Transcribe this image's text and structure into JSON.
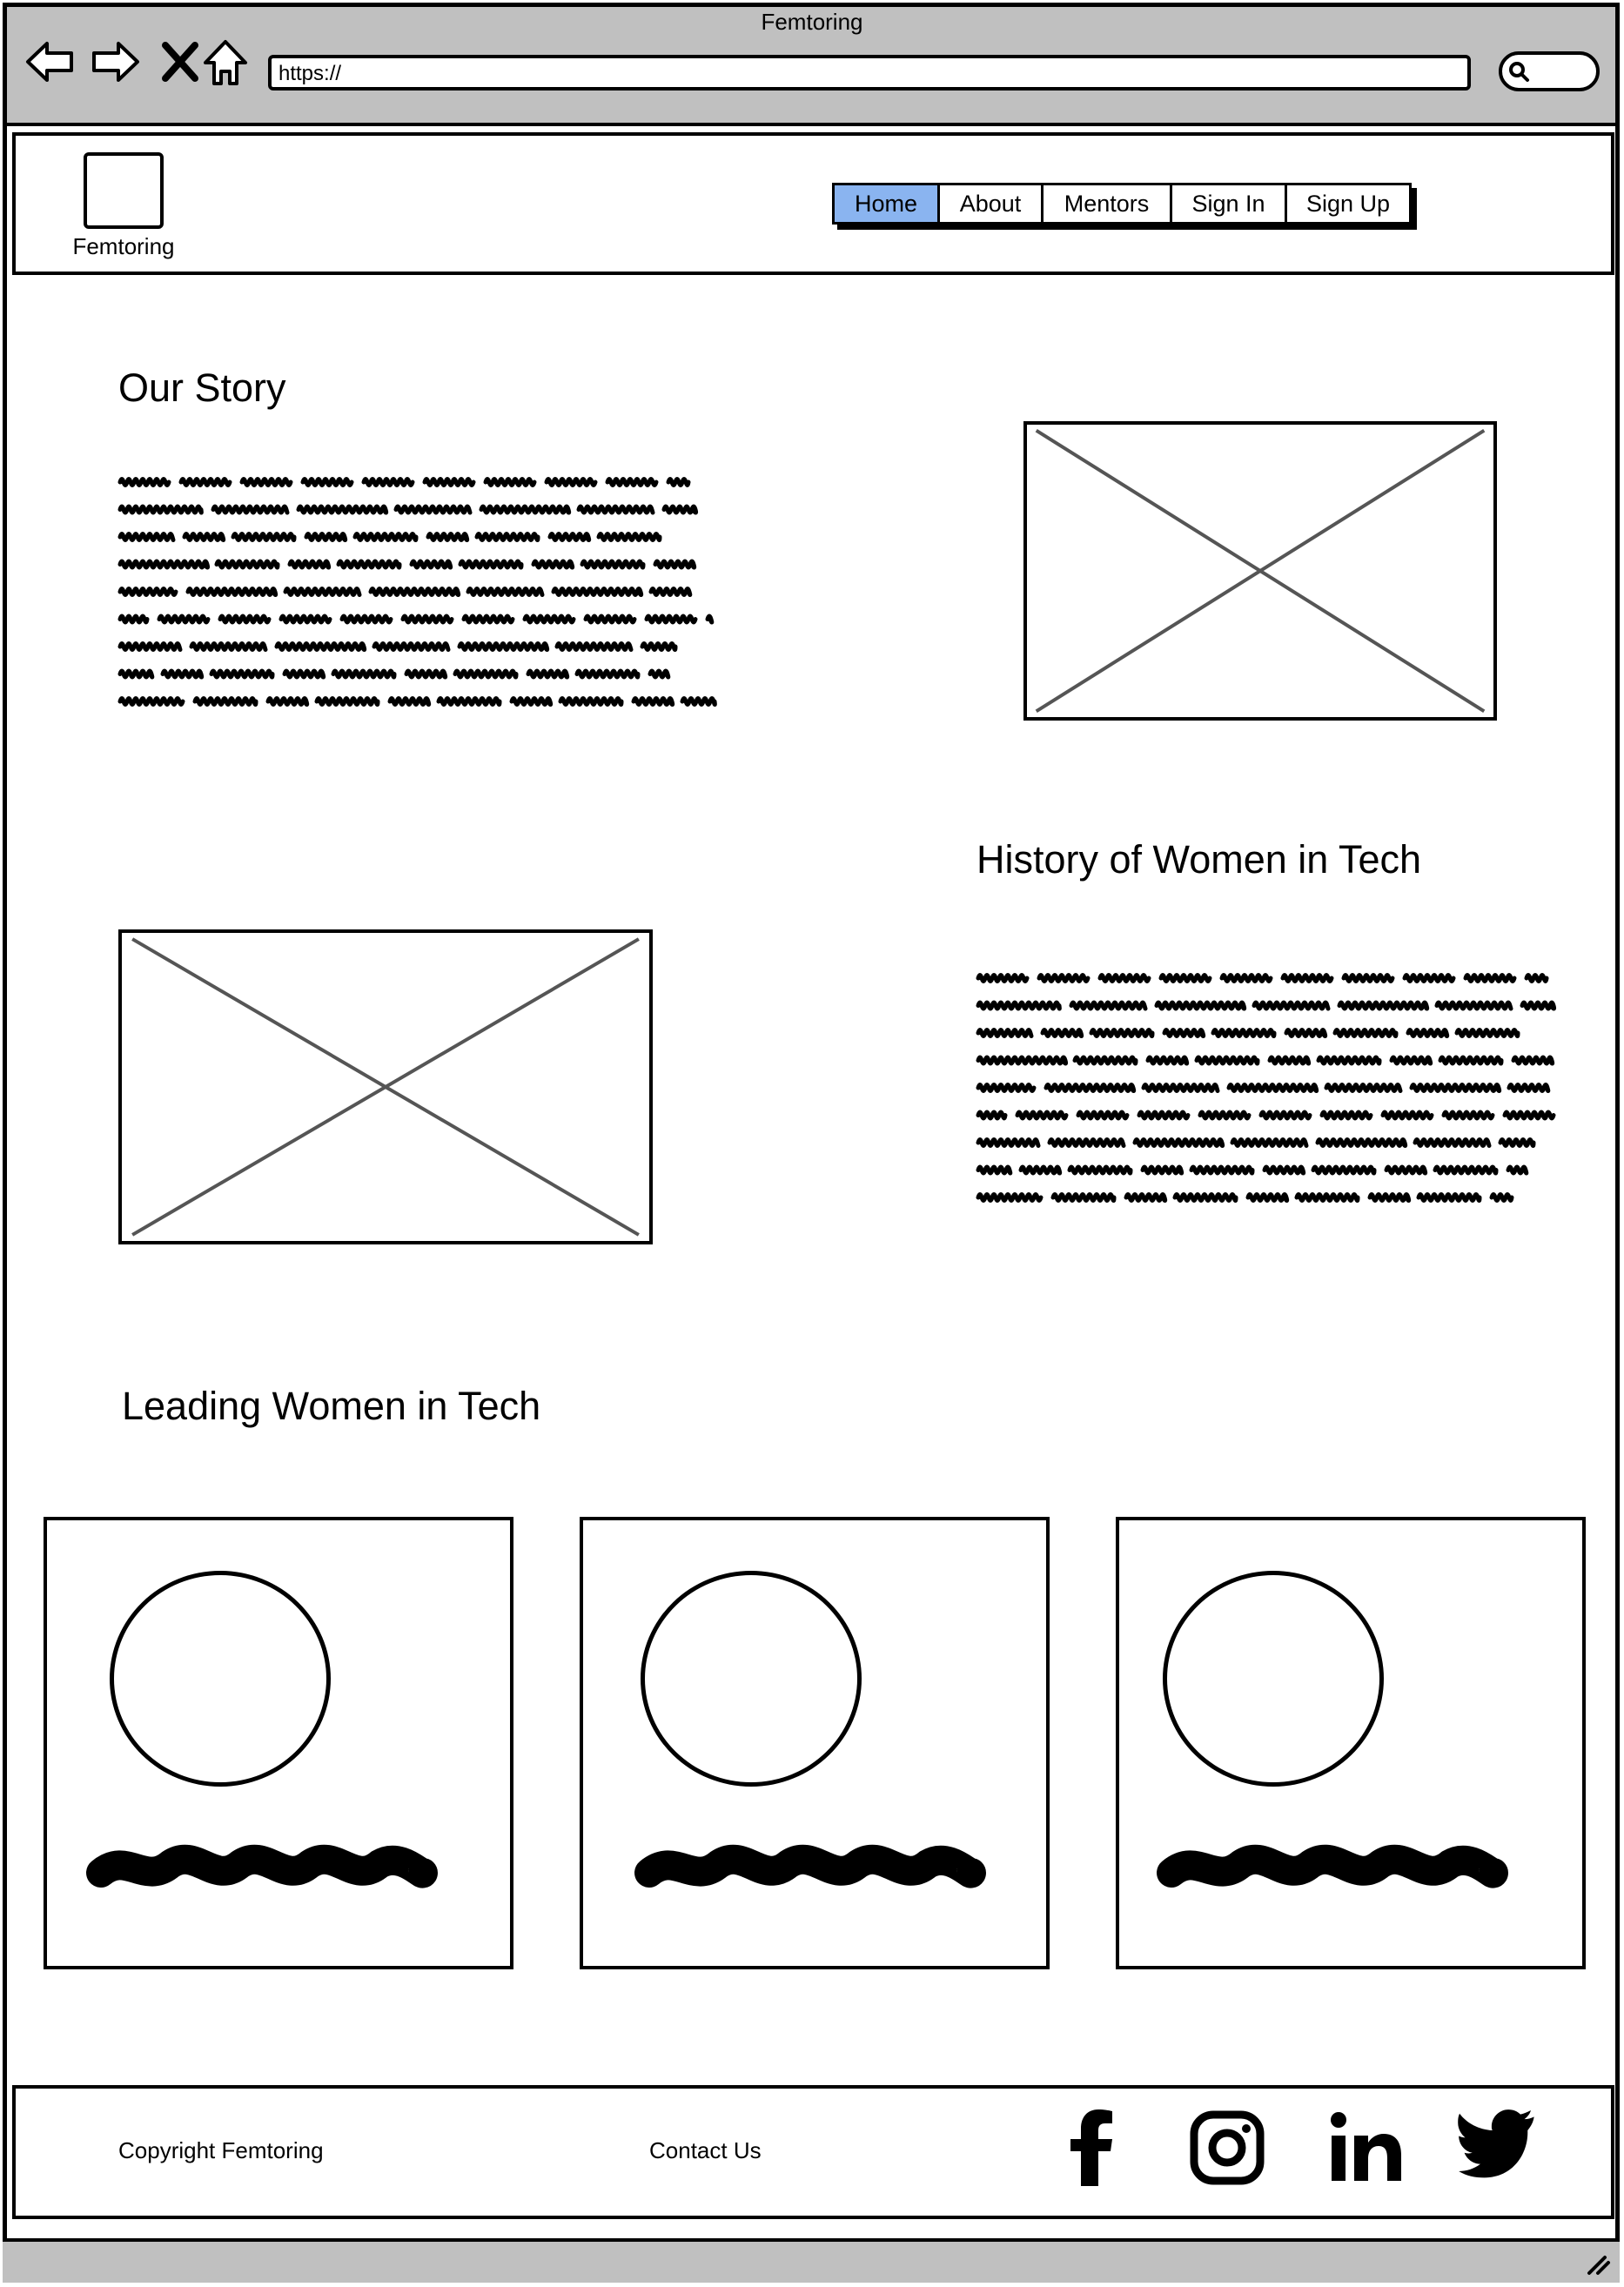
{
  "browser": {
    "window_title": "Femtoring",
    "url": "https://",
    "icons": [
      "back-arrow-icon",
      "forward-arrow-icon",
      "close-x-icon",
      "home-icon",
      "search-icon"
    ]
  },
  "header": {
    "logo_text": "Femtoring",
    "nav": [
      {
        "label": "Home",
        "active": true
      },
      {
        "label": "About",
        "active": false
      },
      {
        "label": "Mentors",
        "active": false
      },
      {
        "label": "Sign In",
        "active": false
      },
      {
        "label": "Sign Up",
        "active": false
      }
    ],
    "active_color": "#8ab4f0"
  },
  "sections": {
    "our_story": {
      "title": "Our Story"
    },
    "history": {
      "title": "History of Women in Tech"
    },
    "leading": {
      "title": "Leading Women in Tech",
      "cards_count": 3
    }
  },
  "footer": {
    "copyright": "Copyright Femtoring",
    "contact": "Contact Us",
    "social_icons": [
      "facebook-icon",
      "instagram-icon",
      "linkedin-icon",
      "twitter-icon"
    ]
  }
}
